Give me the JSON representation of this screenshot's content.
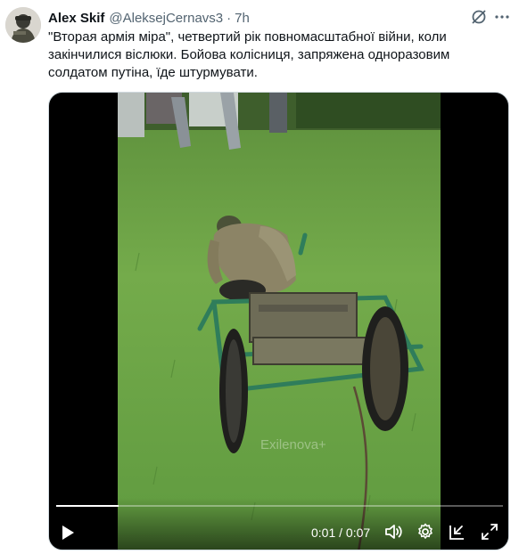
{
  "author": {
    "display_name": "Alex Skif",
    "handle": "@AleksejCernavs3",
    "separator": "·",
    "time": "7h"
  },
  "icons": {
    "grok": "grok-icon",
    "more": "more-icon"
  },
  "tweet": {
    "text": "\"Вторая армія міра\", четвертий рік повномасштабної війни, коли закінчилися віслюки. Бойова колісниця, запряжена одноразовим солдатом путіна, їде штурмувати."
  },
  "video": {
    "current_time": "0:01",
    "duration": "0:07",
    "time_separator": " / ",
    "progress_fraction": 0.14,
    "watermark": "Exilenova+",
    "controls": [
      "play-icon",
      "volume-icon",
      "settings-icon",
      "pip-icon",
      "fullscreen-icon"
    ]
  },
  "colors": {
    "text_primary": "#0f1419",
    "text_secondary": "#536471",
    "grass": "#6fa64a",
    "cart_frame": "#2f7d5b"
  }
}
